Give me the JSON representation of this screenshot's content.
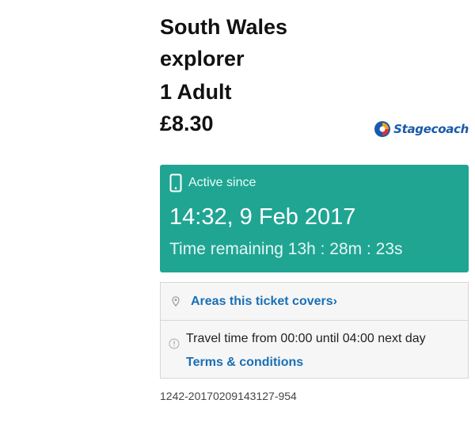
{
  "ticket": {
    "title": "South Wales explorer",
    "passenger": "1 Adult",
    "price": "£8.30",
    "operator_logo_text": "Stagecoach",
    "operator_brand_color": "#1a5aa8"
  },
  "active": {
    "label": "Active since",
    "icon": "phone-icon",
    "since": "14:32, 9 Feb 2017",
    "remaining": "Time remaining 13h : 28m : 23s",
    "card_color": "#20a593"
  },
  "info": {
    "areas_icon": "location-pin-icon",
    "areas_link": "Areas this ticket covers",
    "areas_chevron": "›",
    "travel_icon": "info-icon",
    "travel_time": "Travel time from 00:00 until 04:00 next day",
    "terms_link": "Terms & conditions",
    "link_color": "#1a6fb5"
  },
  "reference": "1242-20170209143127-954"
}
